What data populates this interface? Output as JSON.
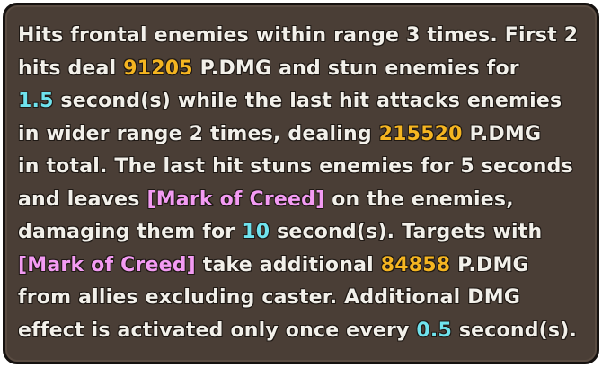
{
  "skill_tooltip": {
    "colors": {
      "text": "#f2f0ea",
      "damage_value": "#f5b521",
      "duration_value": "#6fe3ee",
      "keyword": "#f39bf3",
      "panel_background": "#4a3e36",
      "panel_border": "#161210"
    },
    "lines": [
      {
        "a": "Hits frontal enemies within range 3 times. First 2"
      },
      {
        "a": "hits deal ",
        "b": "91205",
        "c": " P.DMG and stun enemies for"
      },
      {
        "a": "1.5",
        "b": " second(s) while the last hit attacks enemies"
      },
      {
        "a": "in wider range 2 times, dealing ",
        "b": "215520",
        "c": " P.DMG"
      },
      {
        "a": "in total. The last hit stuns enemies for 5 seconds"
      },
      {
        "a": "and leaves ",
        "b": "[Mark of Creed]",
        "c": " on the enemies,"
      },
      {
        "a": "damaging them for ",
        "b": "10",
        "c": " second(s). Targets with"
      },
      {
        "a": "[Mark of Creed]",
        "b": " take additional ",
        "c": "84858",
        "d": " P.DMG"
      },
      {
        "a": "from allies excluding caster. Additional DMG"
      },
      {
        "a": "effect is activated only once every ",
        "b": "0.5",
        "c": " second(s)."
      }
    ]
  }
}
